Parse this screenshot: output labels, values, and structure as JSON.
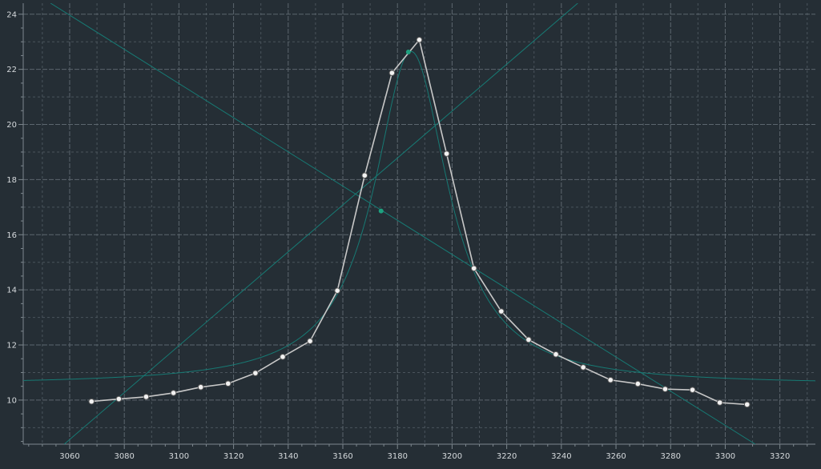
{
  "chart_data": {
    "type": "line",
    "title": "",
    "xlabel": "",
    "ylabel": "",
    "xlim": [
      3043,
      3333
    ],
    "ylim": [
      8.4,
      24.4
    ],
    "xticks": [
      3060,
      3080,
      3100,
      3120,
      3140,
      3160,
      3180,
      3200,
      3220,
      3240,
      3260,
      3280,
      3300,
      3320
    ],
    "yticks": [
      10,
      12,
      14,
      16,
      18,
      20,
      22,
      24
    ],
    "grid": true,
    "series": [
      {
        "role": "measured",
        "color": "#c8c8c8",
        "x": [
          3068,
          3078,
          3088,
          3098,
          3108,
          3118,
          3128,
          3138,
          3148,
          3158,
          3168,
          3178,
          3188,
          3198,
          3208,
          3218,
          3228,
          3238,
          3248,
          3258,
          3268,
          3278,
          3288,
          3298,
          3308
        ],
        "y": [
          9.95,
          10.04,
          10.12,
          10.26,
          10.47,
          10.6,
          10.98,
          11.57,
          12.14,
          13.97,
          18.15,
          21.87,
          23.07,
          18.94,
          14.78,
          13.22,
          12.19,
          11.66,
          11.19,
          10.73,
          10.59,
          10.4,
          10.37,
          9.91,
          9.84
        ]
      },
      {
        "role": "fitted-peak",
        "color": "#177a74",
        "baseline": 10.55,
        "amplitude": 12.1,
        "center": 3185,
        "hwhm": 16.5,
        "x_range": [
          3043,
          3333
        ]
      },
      {
        "role": "rising-line",
        "color": "#177a74",
        "x": [
          3058,
          3246
        ],
        "y": [
          8.4,
          24.4
        ]
      },
      {
        "role": "falling-line",
        "color": "#177a74",
        "x": [
          3053,
          3311
        ],
        "y": [
          24.4,
          8.4
        ]
      }
    ],
    "markers": [
      {
        "x": 3174,
        "y": 16.86,
        "color": "#1ea17f"
      },
      {
        "x": 3184,
        "y": 22.63,
        "color": "#1ea17f"
      }
    ]
  }
}
